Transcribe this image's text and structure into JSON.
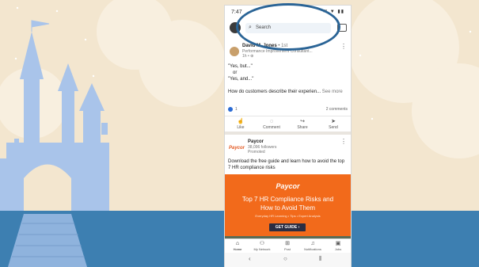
{
  "status": {
    "time": "7:47",
    "icons": "✉ ▼ ▮▮"
  },
  "topbar": {
    "search_placeholder": "Search"
  },
  "post1": {
    "author": "David M. Jones",
    "degree": "• 1st",
    "title": "Performance Improvement Consultant...",
    "time": "1h • ⊕",
    "line1": "\"Yes, but...\"",
    "line2": "or",
    "line3": "\"Yes, and...\"",
    "line4": "How do customers describe their experien...",
    "see_more": "See more",
    "reaction_count": "1",
    "comments": "2 comments",
    "actions": [
      "Like",
      "Comment",
      "Share",
      "Send"
    ]
  },
  "post2": {
    "logo": "Paycor",
    "name": "Paycor",
    "followers": "38,096 followers",
    "promoted": "Promoted",
    "text": "Download the free guide and learn how to avoid the top 7 HR compliance risks"
  },
  "ad": {
    "logo": "Paycor",
    "headline1": "Top 7 HR Compliance Risks and",
    "headline2": "How to Avoid Them",
    "sub": "Everyday HR Learning • Tips • Expert Analysis",
    "button": "GET GUIDE ›"
  },
  "bottomnav": {
    "items": [
      "Home",
      "My Network",
      "Post",
      "Notifications",
      "Jobs"
    ]
  },
  "colors": {
    "accent": "#f26a1b",
    "oval": "#2a6496",
    "castle": "#a9c4ea",
    "water": "#3d7fb1"
  }
}
